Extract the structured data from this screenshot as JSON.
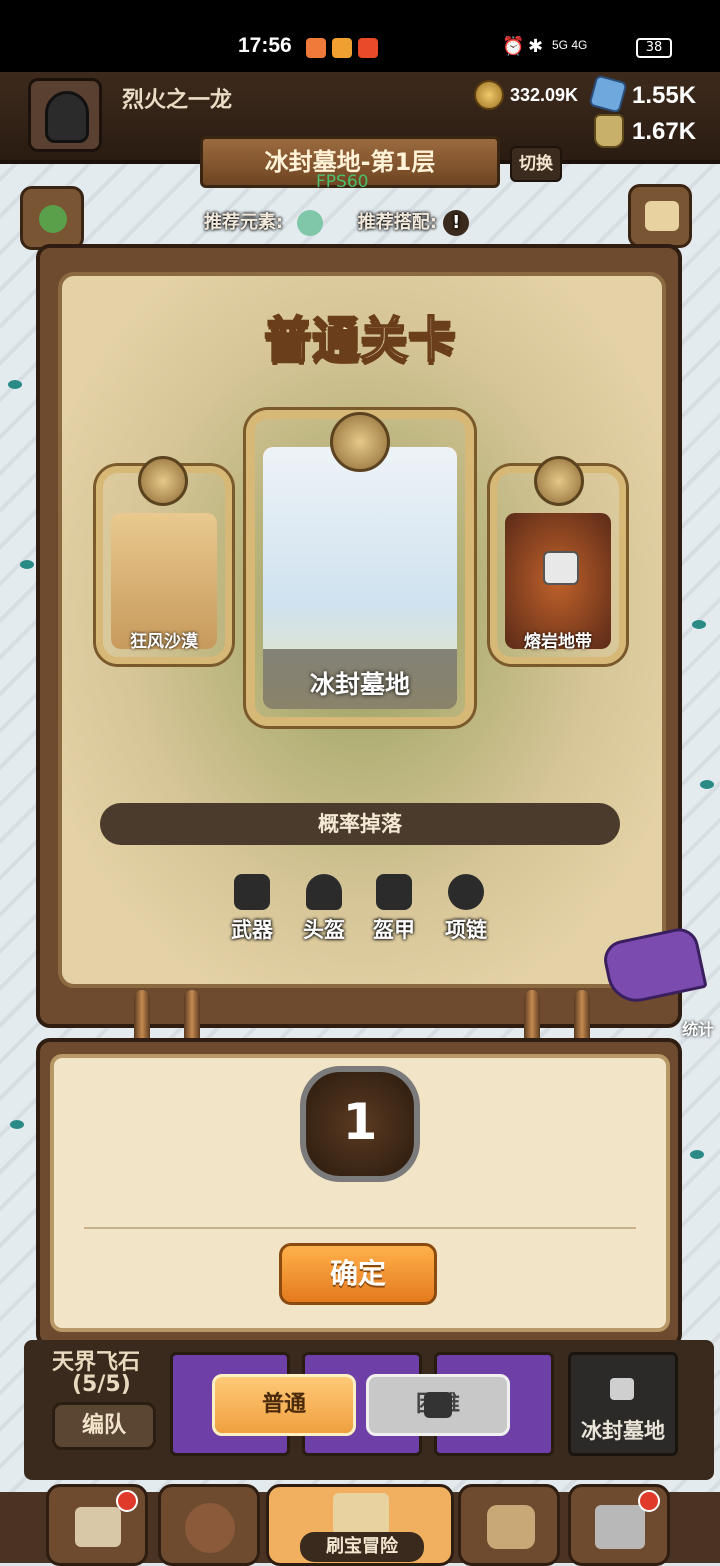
{
  "status_bar": {
    "time": "17:56",
    "network": "5G 4G",
    "battery": "38"
  },
  "player": {
    "name": "烈火之一龙"
  },
  "resources": {
    "gold": "332.09K",
    "gems": "1.55K",
    "potion": "1.67K"
  },
  "stage": {
    "title": "冰封墓地-第1层",
    "fps": "FPS60",
    "switch_label": "切换",
    "recommend_element": "推荐元素:",
    "recommend_combo": "推荐搭配:"
  },
  "panel": {
    "title": "普通关卡",
    "maps": [
      {
        "name": "狂风沙漠",
        "locked": false
      },
      {
        "name": "冰封墓地",
        "locked": false
      },
      {
        "name": "熔岩地带",
        "locked": true
      }
    ],
    "drop_title": "概率掉落",
    "drops": [
      "武器",
      "头盔",
      "盔甲",
      "项链"
    ]
  },
  "selector": {
    "level": "1",
    "confirm_label": "确定"
  },
  "side": {
    "stats_label": "统计"
  },
  "team": {
    "label": "天界飞石",
    "count": "(5/5)",
    "form_button": "编队"
  },
  "mode": {
    "normal_label": "普通",
    "hard_label": "困难"
  },
  "locked_map": {
    "name": "冰封墓地"
  },
  "nav": {
    "active_label": "刷宝冒险"
  },
  "colors": {
    "accent": "#f0a040",
    "panel_brown": "#6e4a2e",
    "paper": "#e4d2a6"
  }
}
